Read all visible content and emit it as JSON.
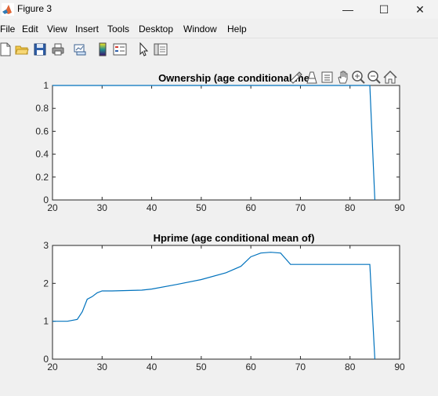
{
  "window": {
    "title": "Figure 3",
    "minimize_glyph": "—",
    "maximize_glyph": "☐",
    "close_glyph": "✕"
  },
  "menu": [
    "File",
    "Edit",
    "View",
    "Insert",
    "Tools",
    "Desktop",
    "Window",
    "Help"
  ],
  "toolbar_icons": [
    "new-figure-icon",
    "open-file-icon",
    "save-icon",
    "print-icon",
    "link-plot-icon",
    "colorbar-icon",
    "legend-icon",
    "pointer-icon",
    "property-inspector-icon"
  ],
  "axes_toolbar_icons": [
    "brush-icon",
    "data-tips-icon",
    "export-icon",
    "pan-icon",
    "zoom-in-icon",
    "zoom-out-icon",
    "home-icon"
  ],
  "colors": {
    "line": "#0072BD",
    "axes_bg": "#ffffff",
    "figure_bg": "#f0f0f0"
  },
  "chart_data": [
    {
      "type": "line",
      "title": "Ownership (age conditional me",
      "xlim": [
        20,
        90
      ],
      "ylim": [
        0,
        1
      ],
      "xticks": [
        "20",
        "30",
        "40",
        "50",
        "60",
        "70",
        "80",
        "90"
      ],
      "yticks": [
        "0",
        "0.2",
        "0.4",
        "0.6",
        "0.8",
        "1"
      ],
      "x": [
        20,
        84,
        85
      ],
      "y": [
        1,
        1,
        0
      ]
    },
    {
      "type": "line",
      "title": "Hprime (age conditional mean of)",
      "xlim": [
        20,
        90
      ],
      "ylim": [
        0,
        3
      ],
      "xticks": [
        "20",
        "30",
        "40",
        "50",
        "60",
        "70",
        "80",
        "90"
      ],
      "yticks": [
        "0",
        "1",
        "2",
        "3"
      ],
      "x": [
        20,
        23,
        25,
        26,
        27,
        28,
        29,
        30,
        32,
        35,
        38,
        40,
        45,
        50,
        55,
        58,
        60,
        62,
        64,
        66,
        67,
        68,
        70,
        75,
        80,
        84,
        85
      ],
      "y": [
        1.0,
        1.0,
        1.05,
        1.25,
        1.58,
        1.65,
        1.75,
        1.8,
        1.8,
        1.81,
        1.82,
        1.85,
        1.97,
        2.1,
        2.28,
        2.45,
        2.7,
        2.8,
        2.82,
        2.8,
        2.65,
        2.5,
        2.5,
        2.5,
        2.5,
        2.5,
        0.0
      ]
    }
  ]
}
